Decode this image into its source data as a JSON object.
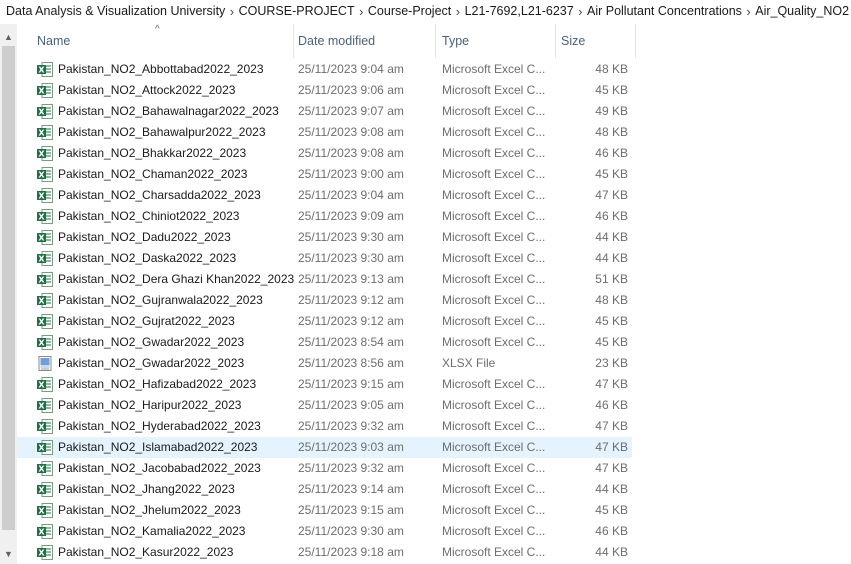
{
  "breadcrumb": [
    "Data Analysis & Visualization University",
    "COURSE-PROJECT",
    "Course-Project",
    "L21-7692,L21-6237",
    "Air Pollutant Concentrations",
    "Air_Quality_NO2"
  ],
  "columns": {
    "name": "Name",
    "date": "Date modified",
    "type": "Type",
    "size": "Size"
  },
  "files": [
    {
      "name": "Pakistan_NO2_Abbottabad2022_2023",
      "date": "25/11/2023 9:04 am",
      "type": "Microsoft Excel C...",
      "size": "48 KB",
      "icon": "excel-csv-icon"
    },
    {
      "name": "Pakistan_NO2_Attock2022_2023",
      "date": "25/11/2023 9:06 am",
      "type": "Microsoft Excel C...",
      "size": "45 KB",
      "icon": "excel-csv-icon"
    },
    {
      "name": "Pakistan_NO2_Bahawalnagar2022_2023",
      "date": "25/11/2023 9:07 am",
      "type": "Microsoft Excel C...",
      "size": "49 KB",
      "icon": "excel-csv-icon"
    },
    {
      "name": "Pakistan_NO2_Bahawalpur2022_2023",
      "date": "25/11/2023 9:08 am",
      "type": "Microsoft Excel C...",
      "size": "48 KB",
      "icon": "excel-csv-icon"
    },
    {
      "name": "Pakistan_NO2_Bhakkar2022_2023",
      "date": "25/11/2023 9:08 am",
      "type": "Microsoft Excel C...",
      "size": "46 KB",
      "icon": "excel-csv-icon"
    },
    {
      "name": "Pakistan_NO2_Chaman2022_2023",
      "date": "25/11/2023 9:00 am",
      "type": "Microsoft Excel C...",
      "size": "45 KB",
      "icon": "excel-csv-icon"
    },
    {
      "name": "Pakistan_NO2_Charsadda2022_2023",
      "date": "25/11/2023 9:04 am",
      "type": "Microsoft Excel C...",
      "size": "47 KB",
      "icon": "excel-csv-icon"
    },
    {
      "name": "Pakistan_NO2_Chiniot2022_2023",
      "date": "25/11/2023 9:09 am",
      "type": "Microsoft Excel C...",
      "size": "46 KB",
      "icon": "excel-csv-icon"
    },
    {
      "name": "Pakistan_NO2_Dadu2022_2023",
      "date": "25/11/2023 9:30 am",
      "type": "Microsoft Excel C...",
      "size": "44 KB",
      "icon": "excel-csv-icon"
    },
    {
      "name": "Pakistan_NO2_Daska2022_2023",
      "date": "25/11/2023 9:30 am",
      "type": "Microsoft Excel C...",
      "size": "44 KB",
      "icon": "excel-csv-icon"
    },
    {
      "name": "Pakistan_NO2_Dera Ghazi Khan2022_2023",
      "date": "25/11/2023 9:13 am",
      "type": "Microsoft Excel C...",
      "size": "51 KB",
      "icon": "excel-csv-icon"
    },
    {
      "name": "Pakistan_NO2_Gujranwala2022_2023",
      "date": "25/11/2023 9:12 am",
      "type": "Microsoft Excel C...",
      "size": "48 KB",
      "icon": "excel-csv-icon"
    },
    {
      "name": "Pakistan_NO2_Gujrat2022_2023",
      "date": "25/11/2023 9:12 am",
      "type": "Microsoft Excel C...",
      "size": "45 KB",
      "icon": "excel-csv-icon"
    },
    {
      "name": "Pakistan_NO2_Gwadar2022_2023",
      "date": "25/11/2023 8:54 am",
      "type": "Microsoft Excel C...",
      "size": "45 KB",
      "icon": "excel-csv-icon"
    },
    {
      "name": "Pakistan_NO2_Gwadar2022_2023",
      "date": "25/11/2023 8:56 am",
      "type": "XLSX File",
      "size": "23 KB",
      "icon": "xlsx-file-icon"
    },
    {
      "name": "Pakistan_NO2_Hafizabad2022_2023",
      "date": "25/11/2023 9:15 am",
      "type": "Microsoft Excel C...",
      "size": "47 KB",
      "icon": "excel-csv-icon"
    },
    {
      "name": "Pakistan_NO2_Haripur2022_2023",
      "date": "25/11/2023 9:05 am",
      "type": "Microsoft Excel C...",
      "size": "46 KB",
      "icon": "excel-csv-icon"
    },
    {
      "name": "Pakistan_NO2_Hyderabad2022_2023",
      "date": "25/11/2023 9:32 am",
      "type": "Microsoft Excel C...",
      "size": "47 KB",
      "icon": "excel-csv-icon"
    },
    {
      "name": "Pakistan_NO2_Islamabad2022_2023",
      "date": "25/11/2023 9:03 am",
      "type": "Microsoft Excel C...",
      "size": "47 KB",
      "icon": "excel-csv-icon",
      "selected": true
    },
    {
      "name": "Pakistan_NO2_Jacobabad2022_2023",
      "date": "25/11/2023 9:32 am",
      "type": "Microsoft Excel C...",
      "size": "47 KB",
      "icon": "excel-csv-icon"
    },
    {
      "name": "Pakistan_NO2_Jhang2022_2023",
      "date": "25/11/2023 9:14 am",
      "type": "Microsoft Excel C...",
      "size": "44 KB",
      "icon": "excel-csv-icon"
    },
    {
      "name": "Pakistan_NO2_Jhelum2022_2023",
      "date": "25/11/2023 9:15 am",
      "type": "Microsoft Excel C...",
      "size": "45 KB",
      "icon": "excel-csv-icon"
    },
    {
      "name": "Pakistan_NO2_Kamalia2022_2023",
      "date": "25/11/2023 9:30 am",
      "type": "Microsoft Excel C...",
      "size": "46 KB",
      "icon": "excel-csv-icon"
    },
    {
      "name": "Pakistan_NO2_Kasur2022_2023",
      "date": "25/11/2023 9:18 am",
      "type": "Microsoft Excel C...",
      "size": "44 KB",
      "icon": "excel-csv-icon"
    }
  ],
  "colors": {
    "excel_green": "#1d7044",
    "selection": "#e5f3ff",
    "header_text": "#4c607a",
    "muted_text": "#6d6d6d"
  }
}
